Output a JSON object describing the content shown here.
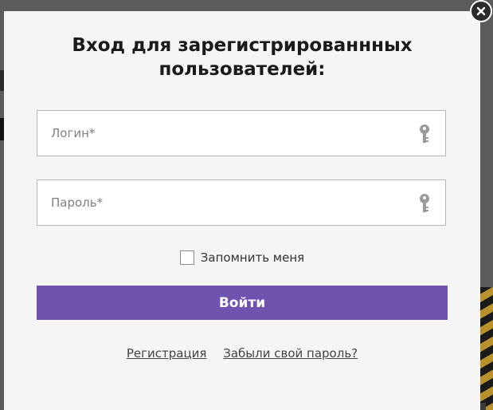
{
  "modal": {
    "title": "Вход для зарегистрированнных пользователей:"
  },
  "login_field": {
    "placeholder": "Логин*",
    "icon": "key-icon"
  },
  "password_field": {
    "placeholder": "Пароль*",
    "icon": "key-icon"
  },
  "remember": {
    "label": "Запомнить меня",
    "checked": false
  },
  "submit": {
    "label": "Войти",
    "color": "#7053ae"
  },
  "links": {
    "register": "Регистрация",
    "forgot": "Забыли свой пароль?"
  },
  "close": {
    "icon": "close-icon"
  }
}
